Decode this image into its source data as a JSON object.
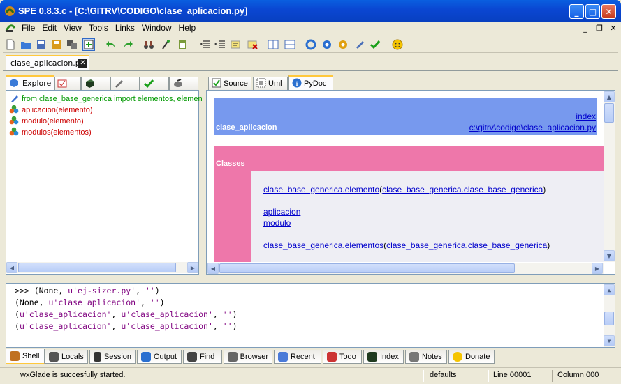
{
  "window": {
    "title": "SPE 0.8.3.c - [C:\\GITRV\\CODIGO\\clase_aplicacion.py]"
  },
  "menu": [
    "File",
    "Edit",
    "View",
    "Tools",
    "Links",
    "Window",
    "Help"
  ],
  "document_tab": {
    "label": "clase_aplicacion.py"
  },
  "left_tabs": {
    "explore": "Explore"
  },
  "tree": [
    {
      "text": "from clase_base_generica import elementos, elemen",
      "color": "#009900",
      "icon": "import-icon"
    },
    {
      "text": "aplicacion(elemento)",
      "color": "#cc0000",
      "icon": "class-icon"
    },
    {
      "text": "modulo(elemento)",
      "color": "#cc0000",
      "icon": "class-icon"
    },
    {
      "text": "modulos(elementos)",
      "color": "#cc0000",
      "icon": "class-icon"
    }
  ],
  "right_tabs": {
    "source": "Source",
    "uml": "Uml",
    "pydoc": "PyDoc"
  },
  "pydoc": {
    "module_name": "clase_aplicacion",
    "index_link": "index",
    "path_link": "c:\\gitrv\\codigo\\clase_aplicacion.py",
    "classes_title": "Classes",
    "lines": [
      {
        "a": "clase_base_generica.elemento",
        "paren_open": "(",
        "b": "clase_base_generica.clase_base_generica",
        "paren_close": ")"
      },
      {
        "a": "aplicacion"
      },
      {
        "a": "modulo"
      },
      {
        "a": "clase_base_generica.elementos",
        "paren_open": "(",
        "b": "clase_base_generica.clase_base_generica",
        "paren_close": ")"
      }
    ]
  },
  "shell": {
    "lines": [
      {
        "prompt": ">>> ",
        "p1": "(None, ",
        "s1": "u'ej-sizer.py'",
        "p2": ", ",
        "s2": "''",
        "p3": ")"
      },
      {
        "prompt": "",
        "p1": "(None, ",
        "s1": "u'clase_aplicacion'",
        "p2": ", ",
        "s2": "''",
        "p3": ")"
      },
      {
        "prompt": "",
        "p1": "(",
        "s1": "u'clase_aplicacion'",
        "p2": ", ",
        "s2": "u'clase_aplicacion'",
        "p3": ", ",
        "s3": "''",
        "p4": ")"
      },
      {
        "prompt": "",
        "p1": "(",
        "s1": "u'clase_aplicacion'",
        "p2": ", ",
        "s2": "u'clase_aplicacion'",
        "p3": ", ",
        "s3": "''",
        "p4": ")"
      }
    ]
  },
  "bottom_tabs": [
    "Shell",
    "Locals",
    "Session",
    "Output",
    "Find",
    "Browser",
    "Recent",
    "Todo",
    "Index",
    "Notes",
    "Donate"
  ],
  "status": {
    "message": "wxGlade is succesfully started.",
    "profile": "defaults",
    "line": "Line 00001",
    "column": "Column 000"
  },
  "colors": {
    "title_blue": "#0a46d2",
    "pydoc_header": "#7799ee",
    "pydoc_classes": "#ee77aa",
    "tab_highlight": "#ffc83c"
  }
}
